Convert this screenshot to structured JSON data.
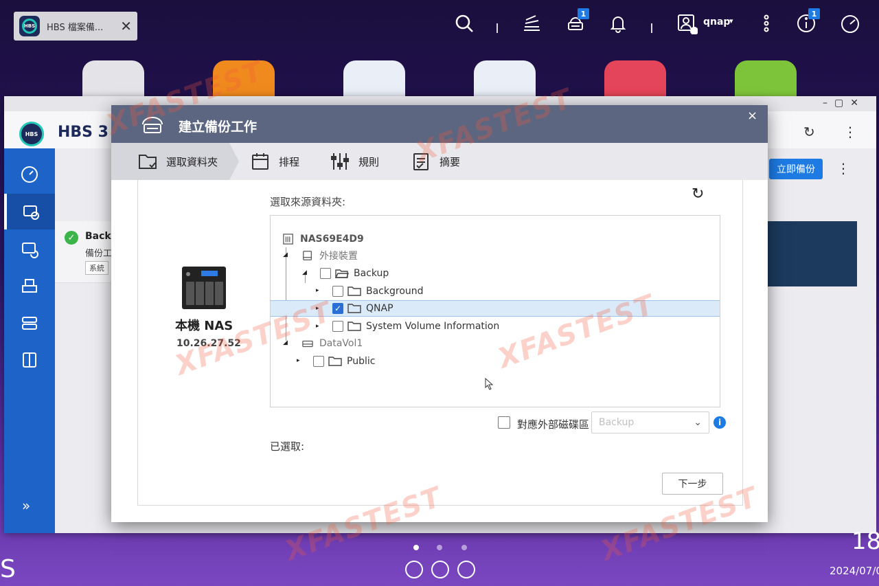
{
  "desktop": {
    "tab_title": "HBS 檔案備...",
    "tab_close": "✕",
    "user": {
      "name": "qnap",
      "caret": "▾"
    },
    "badges": {
      "backup_badge": "1",
      "info_badge": "1"
    },
    "os_letter": "S",
    "clock": {
      "hour": "18",
      "date": "2024/07/0"
    }
  },
  "hbs": {
    "title": "HBS 3",
    "backup_now_button": "立即備份",
    "task": {
      "title": "Backu",
      "subtitle": "備份工",
      "tag": "系統"
    },
    "collapse_icon": "»",
    "refresh_icon": "↻",
    "more_icon": "⋮",
    "window_controls": "–▢✕"
  },
  "modal": {
    "title": "建立備份工作",
    "close": "×",
    "steps": [
      {
        "label": "選取資料夾",
        "icon": "folder-select-icon"
      },
      {
        "label": "排程",
        "icon": "calendar-icon"
      },
      {
        "label": "規則",
        "icon": "sliders-icon"
      },
      {
        "label": "摘要",
        "icon": "clipboard-icon"
      }
    ],
    "nas": {
      "name": "本機 NAS",
      "ip": "10.26.27.52"
    },
    "source_label": "選取來源資料夾:",
    "refresh_icon": "↻",
    "tree": {
      "root": "NAS69E4D9",
      "external": "外接裝置",
      "backup": "Backup",
      "background": "Background",
      "qnap": "QNAP",
      "svi": "System Volume Information",
      "datavol": "DataVol1",
      "public": "Public"
    },
    "external_partition_label": "對應外部磁碟區",
    "external_partition_select": "Backup",
    "select_chevron": "⌄",
    "info_icon": "i",
    "selected_label": "已選取:",
    "next_button": "下一步"
  },
  "colors": {
    "modal_header": "#5c6680",
    "accent_blue": "#1e7be4",
    "hbs_sidebar": "#1d63c8",
    "selected_row": "#dbeaf8"
  }
}
